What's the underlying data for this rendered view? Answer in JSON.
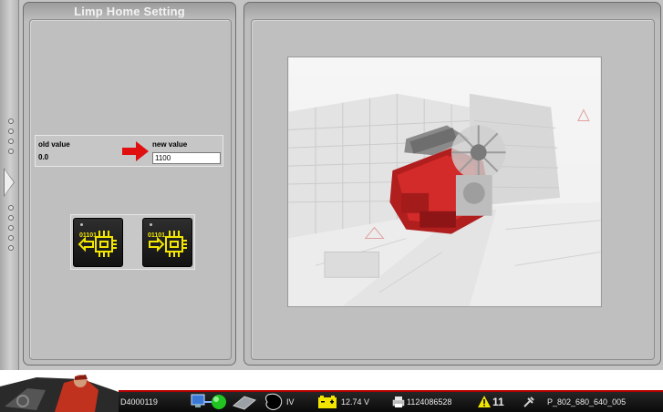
{
  "panel_left": {
    "title": "Limp Home Setting"
  },
  "values": {
    "old_label": "old value",
    "old_value": "0.0",
    "new_label": "new value",
    "new_value": "1100"
  },
  "buttons": [
    {
      "name": "read-ecu-button",
      "icon": "ecu-chip-read-icon",
      "code": "01101"
    },
    {
      "name": "write-ecu-button",
      "icon": "ecu-chip-write-icon",
      "code": "01101"
    }
  ],
  "status_bar": {
    "vehicle_id": "D4000119",
    "ignition": "IV",
    "battery_voltage": "12.74 V",
    "counter": "1124086528",
    "warnings": "11",
    "parameter_set": "P_802_680_640_005"
  },
  "colors": {
    "accent_red": "#e01010",
    "icon_yellow": "#f2e600",
    "status_green": "#22c422"
  }
}
